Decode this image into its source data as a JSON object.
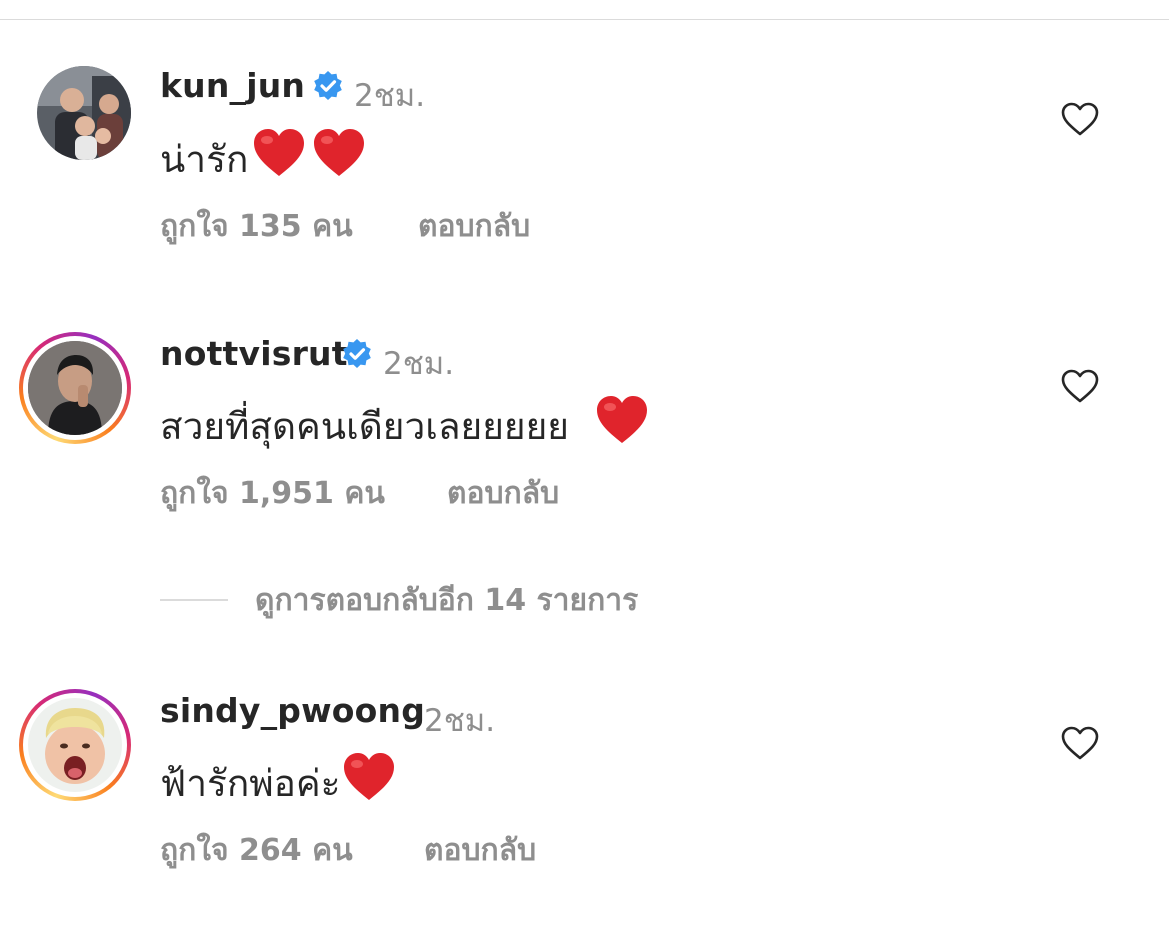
{
  "colors": {
    "primary_text": "#262626",
    "secondary_text": "#8e8e8e",
    "verified_blue": "#3897f0",
    "heart_red": "#ed4956",
    "divider": "#dbdbdb"
  },
  "comments": [
    {
      "username": "kun_jun",
      "verified": true,
      "time": "2ชม.",
      "text": "น่ารัก",
      "emoji": [
        "red-heart-emoji",
        "red-heart-emoji"
      ],
      "likes_label": "ถูกใจ 135 คน",
      "reply_label": "ตอบกลับ",
      "story_ring": false,
      "like_icon": "heart-outline-icon"
    },
    {
      "username": "nottvisrut",
      "verified": true,
      "time": "2ชม.",
      "text": "สวยที่สุดคนเดียวเลยยยยย ",
      "emoji": [
        "red-heart-emoji"
      ],
      "likes_label": "ถูกใจ 1,951 คน",
      "reply_label": "ตอบกลับ",
      "story_ring": true,
      "like_icon": "heart-outline-icon"
    },
    {
      "username": "sindy_pwoong",
      "verified": false,
      "time": "2ชม.",
      "text": "ฟ้ารักพ่อค่ะ",
      "emoji": [
        "red-heart-emoji"
      ],
      "likes_label": "ถูกใจ 264 คน",
      "reply_label": "ตอบกลับ",
      "story_ring": true,
      "like_icon": "heart-outline-icon"
    }
  ],
  "view_replies": {
    "label": "ดูการตอบกลับอีก 14 รายการ"
  }
}
